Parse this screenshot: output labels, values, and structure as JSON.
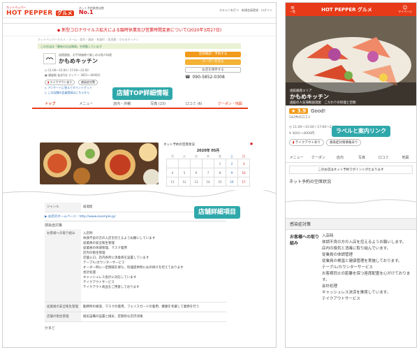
{
  "pc": {
    "logo_top": "ホットペッパー",
    "logo_a": "HOT PEPPER",
    "logo_b": "グルメ",
    "sub": "PRODUCED BY RECRUIT",
    "rank_label": "ネット予約飲食店数",
    "rank_label2": "No.1",
    "links": "スキャンを打つ　新規会員登録　ログイン",
    "notice": "◆ 新型コロナウイルス拡大による臨時休業及び営業時間変更について(2020年3月27日)",
    "crumb": "ホットペッパーグルメ › ホーム › 東京 › 銀座・有楽町 › 居酒屋 › かもめキッチン",
    "greenbar": "このお店は「最新のお店情報」を掲載しています",
    "shop_sub": "函館銀座、お手頃価格で楽しめる魚介料理",
    "shop_name": "かもめキッチン",
    "hours": "11:00～15:00 / 17:00～23:00",
    "access": "銀座駅 徒歩5分",
    "budget_label": "ディナー",
    "budget": "3001～4000円",
    "takeout": "テイクアウトあり",
    "infection": "感染症対策",
    "btn_reserve": "空席確認・予約する",
    "btn_coupon": "クーポンを見る",
    "btn_save": "お店を保存する",
    "phone_label": "電話番号",
    "phone": "090-5852-0308",
    "link1": "▷ アンケートに答えてポイントゲット",
    "link2": "▷ この店舗の会員登録はこちらから",
    "label_top": "店舗TOP詳細情報",
    "tabs": [
      "トップ",
      "メニュー",
      "店内・外観",
      "写真 (23)",
      "口コミ (6)",
      "クーポン・地図"
    ],
    "calendar": {
      "title": "ネット予約の空席状況",
      "month": "2020年 05月",
      "days": [
        "月",
        "火",
        "水",
        "木",
        "金",
        "土",
        "日"
      ],
      "row1": [
        "",
        "",
        "",
        "",
        "1",
        "2",
        "3"
      ],
      "row2": [
        "4",
        "5",
        "6",
        "7",
        "8",
        "9",
        "10"
      ],
      "row3": [
        "11",
        "12",
        "13",
        "14",
        "15",
        "16",
        "17"
      ]
    },
    "label_detail": "店舗詳細項目",
    "detail_k1": "お客様への取り組み",
    "detail_v1": "入店時\n体調不良の方の入店を控えるようお願いしています\n従業員の安全衛生管理\n従業員の体調管理、マスク着用\n店内の衛生管理\n店舗入口、店内各所に消毒液を設置しています\nテーブル/カウンターサービス\nオーダー時に一定間隔を保ち、料理提供時にお声掛けを控えております\n会計処理\nキャッシュレス会計に対応しています\nテイクアウトサービス\nテイクアウト商品をご用意しております",
    "detail_k2": "従業員の安全衛生管理",
    "detail_v2": "勤務時の検温、マスクの着用、フェイスガードの着用、健康を考慮して業務を行う",
    "detail_k3": "店舗の衛生管理",
    "detail_v3": "換気設備の設置と換気、定期的な店内消毒",
    "hp_label": "▶ お店のホームページ : http://www.example.jp/",
    "sect1": "感染症対策",
    "sect2": "かまど",
    "genre": "居酒屋",
    "genre_k": "ジャンル"
  },
  "sp": {
    "menu_label": "一覧",
    "logo": "HOT PEPPER グルメ",
    "mypage": "マイページ",
    "shop_small": "函館銀座エリア",
    "shop_name": "かもめキッチン",
    "shop_sub": "函館の人気海鮮居酒屋　こだわりの料理と空間",
    "rating": "★ 3.9",
    "good": "Good!",
    "review_count": "542件の口コミ",
    "hours": "11:00～15:00 / 17:00～23:00",
    "budget": "3001～4000円",
    "takeout": "テイクアウトあり",
    "infection": "感染症対策情報あり",
    "label_link": "ラベルと案内リンク",
    "tabs": [
      "メニュー",
      "クーポン",
      "店内",
      "写真",
      "口コミ",
      "地図"
    ],
    "net_notice": "このお店はネット予約でポイントがたまります",
    "net_label": "ネット予約の空席状況",
    "detail_title": "感染症対策",
    "detail_k": "お客様への取り組み",
    "detail_v": "入店時\n体調不良の方の入店を控えるようお願いします。\n店内の換気と消毒に取り組んでいます。\n従業員の体調管理\n従業員の検温と健康管理を実施しております。\nテーブル/カウンターサービス\nお客様同士の距離を保つ座席配置を心がけております。\n会計処理\nキャッシュレス決済を推奨しています。\nテイクアウトサービス"
  },
  "colors": {
    "brand": "#e83a18",
    "accent": "#2fa8ab"
  }
}
